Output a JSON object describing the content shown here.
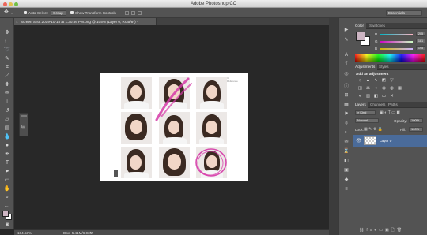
{
  "app": {
    "title": "Adobe Photoshop CC"
  },
  "options": {
    "auto_select_label": "Auto-Select:",
    "auto_select_value": "Group",
    "transform_label": "Show Transform Controls",
    "workspace": "Essentials"
  },
  "document": {
    "tab_title": "Screen Shot 2019-10-15 at 1.30.56 PM.png @ 105% (Layer 0, RGB/8*) *",
    "caption_lines": [
      "IU",
      "Reference"
    ]
  },
  "status": {
    "zoom": "104.53%",
    "doc_info": "Doc: 5.41M/6.93M"
  },
  "color_panel": {
    "tabs": [
      "Color",
      "Swatches"
    ],
    "sliders": [
      {
        "label": "R",
        "value": "205"
      },
      {
        "label": "G",
        "value": "181"
      },
      {
        "label": "B",
        "value": "195"
      }
    ]
  },
  "adjustments_panel": {
    "tabs": [
      "Adjustments",
      "Styles"
    ],
    "heading": "Add an adjustment"
  },
  "layers_panel": {
    "tabs": [
      "Layers",
      "Channels",
      "Paths"
    ],
    "kind_label": "Kind",
    "blend_mode": "Normal",
    "opacity_label": "Opacity:",
    "opacity_value": "100%",
    "lock_label": "Lock:",
    "fill_label": "Fill:",
    "fill_value": "100%",
    "layers": [
      {
        "name": "Layer 0"
      }
    ]
  },
  "colors": {
    "foreground": "#cdb5c3",
    "background": "#ffffff",
    "selection": "#4a6b9a",
    "annotation": "#d63aa8"
  }
}
